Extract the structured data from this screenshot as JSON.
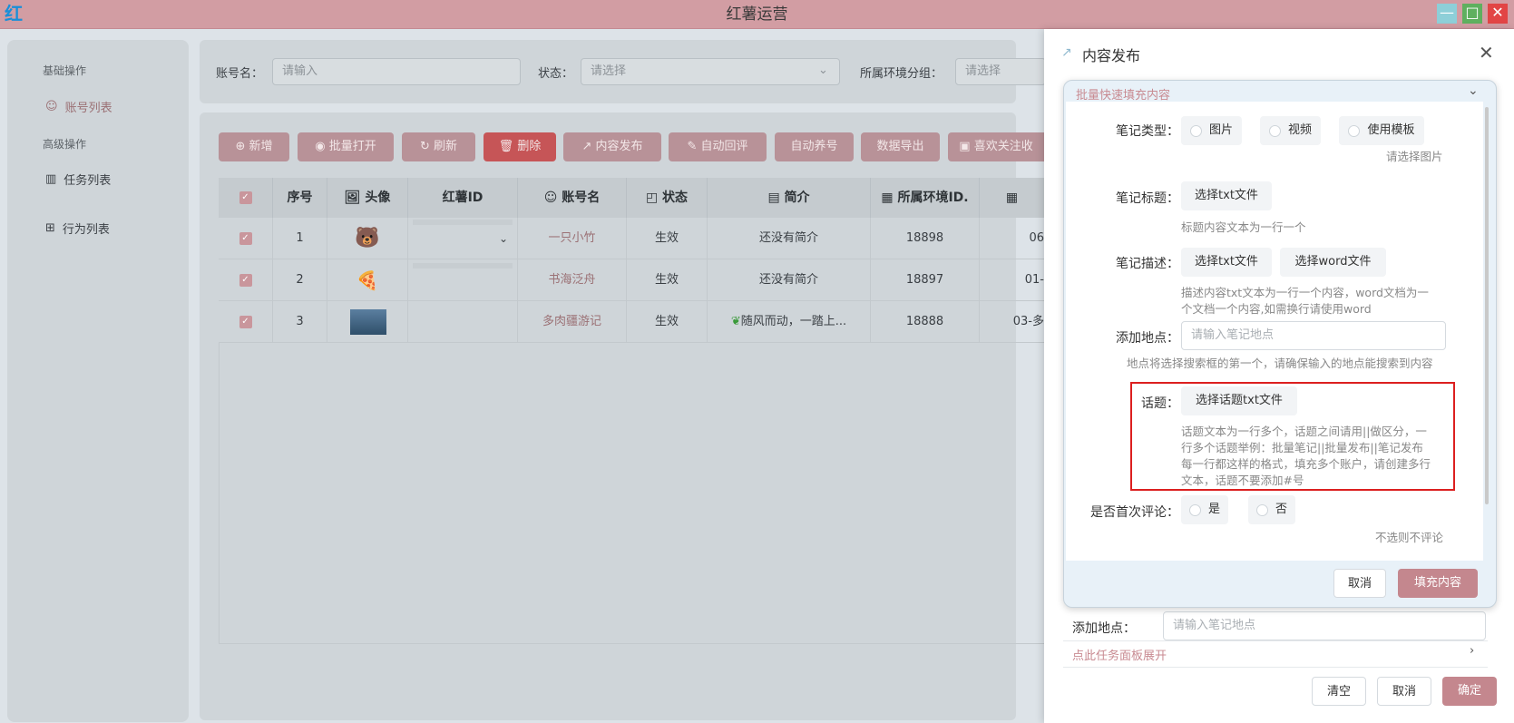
{
  "window": {
    "logo": "红",
    "title": "红薯运营",
    "min": "—",
    "max": "□",
    "close": "✕"
  },
  "sidebar": {
    "basic_head": "基础操作",
    "account_list": "账号列表",
    "adv_head": "高级操作",
    "task_list": "任务列表",
    "behavior_list": "行为列表"
  },
  "filters": {
    "account_label": "账号名：",
    "account_placeholder": "请输入",
    "status_label": "状态：",
    "status_placeholder": "请选择",
    "env_label": "所属环境分组：",
    "env_placeholder": "请选择"
  },
  "toolbar": {
    "add": "新增",
    "batch_open": "批量打开",
    "refresh": "刷新",
    "delete": "删除",
    "publish": "内容发布",
    "auto_reply": "自动回评",
    "auto_nurture": "自动养号",
    "export": "数据导出",
    "like_follow": "喜欢关注收"
  },
  "table": {
    "headers": {
      "index": "序号",
      "avatar": "头像",
      "id": "红薯ID",
      "name": "账号名",
      "status": "状态",
      "intro": "简介",
      "env": "所属环境ID."
    },
    "rows": [
      {
        "index": "1",
        "name": "一只小竹",
        "status": "生效",
        "intro": "还没有简介",
        "env": "18898",
        "extra": "06"
      },
      {
        "index": "2",
        "name": "书海泛舟",
        "status": "生效",
        "intro": "还没有简介",
        "env": "18897",
        "extra": "01-"
      },
      {
        "index": "3",
        "name": "多肉疆游记",
        "status": "生效",
        "intro": "随风而动，一踏上...",
        "env": "18888",
        "extra": "03-多"
      }
    ]
  },
  "drawer": {
    "title": "内容发布",
    "popup_head": "批量快速填充内容",
    "note_type_label": "笔记类型：",
    "opt_image": "图片",
    "opt_video": "视频",
    "opt_template": "使用模板",
    "note_type_hint": "请选择图片",
    "title_label": "笔记标题：",
    "choose_txt": "选择txt文件",
    "title_hint": "标题内容文本为一行一个",
    "desc_label": "笔记描述：",
    "choose_txt2": "选择txt文件",
    "choose_word": "选择word文件",
    "desc_hint1": "描述内容txt文本为一行一个内容，word文档为一",
    "desc_hint2": "个文档一个内容,如需换行请使用word",
    "loc_label": "添加地点：",
    "loc_placeholder": "请输入笔记地点",
    "loc_hint": "地点将选择搜索框的第一个，请确保输入的地点能搜索到内容",
    "topic_label": "话题：",
    "choose_topic": "选择话题txt文件",
    "topic_hint1": "话题文本为一行多个，话题之间请用||做区分，一",
    "topic_hint2": "行多个话题举例：批量笔记||批量发布||笔记发布",
    "topic_hint3": " 每一行都这样的格式，填充多个账户，请创建多行",
    "topic_hint4": "文本，话题不要添加#号",
    "first_comment_label": "是否首次评论：",
    "opt_yes": "是",
    "opt_no": "否",
    "comment_hint": "不选则不评论",
    "popup_cancel": "取消",
    "popup_fill": "填充内容",
    "bg_loc_label": "添加地点：",
    "bg_loc_placeholder": "请输入笔记地点",
    "expand_text": "点此任务面板展开",
    "clear": "清空",
    "cancel": "取消",
    "confirm": "确定"
  }
}
